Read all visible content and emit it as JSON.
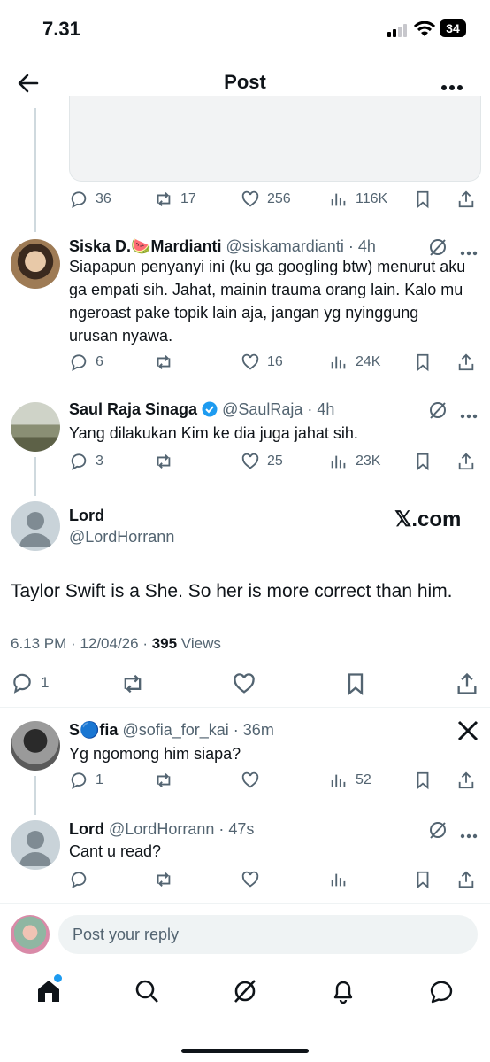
{
  "status": {
    "time": "7.31",
    "battery": "34"
  },
  "header": {
    "title": "Post"
  },
  "top_post": {
    "replies": "36",
    "retweets": "17",
    "likes": "256",
    "views": "116K"
  },
  "replies": [
    {
      "name": "Siska D.",
      "emoji": "🍉",
      "name_tail": "Mardianti",
      "handle": "@siskamardianti",
      "time": "4h",
      "text": "Siapapun penyanyi ini (ku ga googling btw) menurut aku ga empati sih. Jahat, mainin trauma orang lain. Kalo mu ngeroast pake topik lain aja, jangan yg nyinggung urusan nyawa.",
      "replies": "6",
      "likes": "16",
      "views": "24K"
    },
    {
      "name": "Saul Raja Sinaga",
      "handle": "@SaulRaja",
      "time": "4h",
      "text": "Yang dilakukan Kim ke dia juga jahat sih.",
      "replies": "3",
      "likes": "25",
      "views": "23K"
    }
  ],
  "main_post": {
    "name": "Lord",
    "handle": "@LordHorrann",
    "watermark": "𝕏.com",
    "text": "Taylor Swift is a She. So her is more correct than him.",
    "meta_time": "6.13 PM · 12/04/26 · ",
    "views_count": "395",
    "views_label": " Views",
    "replies": "1"
  },
  "sub_replies": [
    {
      "name": "S🔵fia",
      "handle": "@sofia_for_kai",
      "time": "36m",
      "text": "Yg ngomong him siapa?",
      "replies": "1",
      "views": "52"
    },
    {
      "name": "Lord",
      "handle": "@LordHorrann",
      "time": "47s",
      "text": "Cant u read?"
    }
  ],
  "reply_input": {
    "placeholder": "Post your reply"
  }
}
